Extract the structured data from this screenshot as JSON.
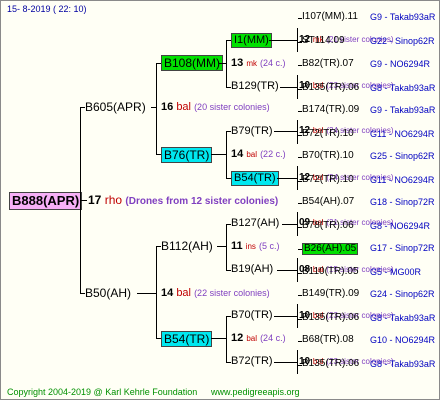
{
  "header": {
    "date": "15-  8-2019 (  22:  10)"
  },
  "footer": {
    "copyright": "Copyright 2004-2019 @ Karl Kehrle Foundation",
    "site": "www.pedigreeapis.org"
  },
  "subject": {
    "id": "B888(APR)",
    "num": "17",
    "type": "rho",
    "note": "(Drones from 12 sister colonies)"
  },
  "g1": [
    {
      "id": "B605(APR)",
      "num": "16",
      "type": "bal",
      "note": "(20 sister colonies)"
    },
    {
      "id": "B50(AH)",
      "num": "14",
      "type": "bal",
      "note": "(22 sister colonies)"
    }
  ],
  "g2": [
    {
      "id": "B108(MM)",
      "num": "13",
      "type": "mk",
      "note": "(24 c.)"
    },
    {
      "id": "B76(TR)",
      "num": "14",
      "type": "bal",
      "note": "(22 c.)"
    },
    {
      "id": "B112(AH)",
      "num": "11",
      "type": "ins",
      "note": "(5 c.)"
    },
    {
      "id": "B54(TR)",
      "num": "12",
      "type": "bal",
      "note": "(24 c.)"
    }
  ],
  "g3": [
    {
      "id": "I1(MM)",
      "num": "12",
      "type": "mk",
      "note": "(21 sister colonies)"
    },
    {
      "id": "B129(TR)",
      "num": "10",
      "type": "bal",
      "note": "(23 sister colonies)"
    },
    {
      "id": "B79(TR)",
      "num": "12",
      "type": "bal",
      "note": "(24 sister colonies)"
    },
    {
      "id": "B54(TR)",
      "num": "12",
      "type": "bal",
      "note": "(24 sister colonies)"
    },
    {
      "id": "B127(AH)",
      "num": "09",
      "type": "bal",
      "note": "(21 sister colonies)"
    },
    {
      "id": "B19(AH)",
      "num": "08",
      "type": "bal",
      "note": "(15 sister colonies)"
    },
    {
      "id": "B70(TR)",
      "num": "10",
      "type": "bal",
      "note": "(23 sister colonies)"
    },
    {
      "id": "B72(TR)",
      "num": "10",
      "type": "bal",
      "note": "(23 sister colonies)"
    }
  ],
  "g4": [
    {
      "id": "I107(MM).11",
      "pos": "G9 - Takab93aR"
    },
    {
      "id": "ST114.09",
      "pos": "G22 - Sinop62R"
    },
    {
      "id": "B82(TR).07",
      "pos": "G9 - NO6294R"
    },
    {
      "id": "B135(TR).06",
      "pos": "G8 - Takab93aR"
    },
    {
      "id": "B174(TR).09",
      "pos": "G9 - Takab93aR"
    },
    {
      "id": "B72(TR).10",
      "pos": "G11 - NO6294R"
    },
    {
      "id": "B70(TR).10",
      "pos": "G25 - Sinop62R"
    },
    {
      "id": "B72(TR).10",
      "pos": "G11 - NO6294R"
    },
    {
      "id": "B54(AH).07",
      "pos": "G18 - Sinop72R"
    },
    {
      "id": "B78(TR).06",
      "pos": "G8 - NO6294R"
    },
    {
      "id": "B26(AH).05",
      "pos": "G17 - Sinop72R",
      "highlight": "green"
    },
    {
      "id": "B110(TR).05",
      "pos": "G5 - MG00R"
    },
    {
      "id": "B149(TR).09",
      "pos": "G24 - Sinop62R"
    },
    {
      "id": "B135(TR).06",
      "pos": "G8 - Takab93aR"
    },
    {
      "id": "B68(TR).08",
      "pos": "G10 - NO6294R"
    },
    {
      "id": "B135(TR).06",
      "pos": "G8 - Takab93aR"
    }
  ]
}
